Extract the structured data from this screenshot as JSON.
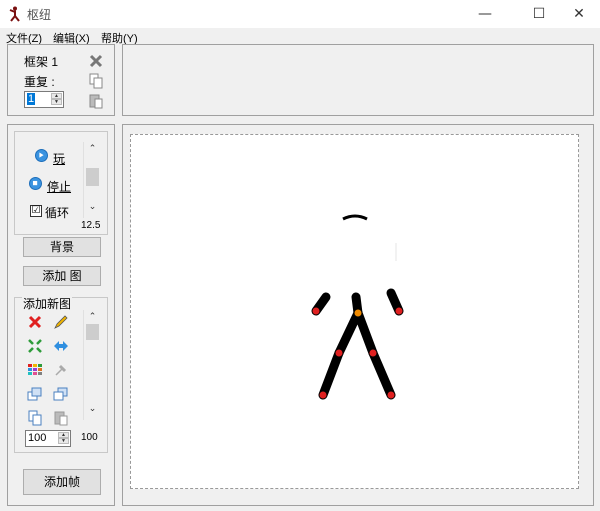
{
  "window": {
    "title": "枢纽",
    "controls": [
      "—",
      "☐",
      "✕"
    ]
  },
  "menu": [
    "文件(Z)",
    "编辑(X)",
    "帮助(Y)"
  ],
  "frame_panel": {
    "frame_label": "框架 1",
    "repeat_label": "重复 :",
    "repeat_value": "1"
  },
  "animation": {
    "play_label": "玩",
    "stop_label": "停止",
    "loop_label": "循环",
    "loop_checked": "☑",
    "speed_value": "12.5"
  },
  "buttons": {
    "background": "背景",
    "add_image": "添加 图",
    "add_frame": "添加帧"
  },
  "figure_panel": {
    "add_new_figure_label": "添加新图",
    "size_value": "100",
    "scale_readout": "100"
  },
  "icons": [
    "stickman-app-icon",
    "delete-frame-icon",
    "copy-frame-icon",
    "paste-frame-icon",
    "delete-figure-icon",
    "edit-figure-icon",
    "center-figure-icon",
    "flip-figure-icon",
    "color-figure-icon",
    "pin-figure-icon",
    "bring-front-icon",
    "send-back-icon",
    "copy-figure-icon",
    "paste-figure-icon"
  ],
  "colors": {
    "joint_red": "#e02020",
    "joint_orange": "#f08a00",
    "limb": "#000000"
  }
}
